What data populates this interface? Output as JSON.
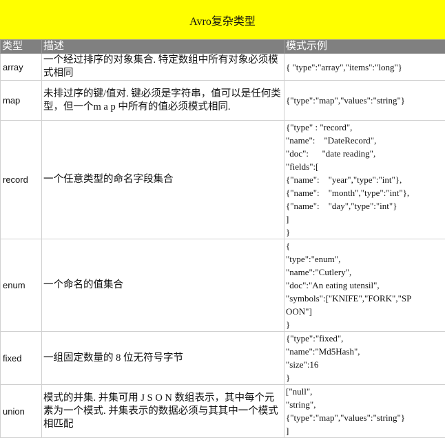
{
  "title": "Avro复杂类型",
  "headers": [
    "类型",
    "描述",
    "模式示例"
  ],
  "rows": [
    {
      "type": "array",
      "desc": "一个经过排序的对象集合. 特定数组中所有对象必须模式相同",
      "schema": "{ \"type\":\"array\",\"items\":\"long\"}"
    },
    {
      "type": "map",
      "desc": "未排过序的键/值对. 键必须是字符串，值可以是任何类型，但一个m a p 中所有的值必须模式相同.",
      "schema": "{\"type\":\"map\",\"values\":\"string\"}"
    },
    {
      "type": "record",
      "desc": "一个任意类型的命名字段集合",
      "schema": "{\"type\" : \"record\",\n\"name\":    \"DateRecord\",\n\"doc\":      \"date reading\",\n\"fields\":[\n{\"name\":    \"year\",\"type\":\"int\"},\n{\"name\":    \"month\",\"type\":\"int\"},\n{\"name\":    \"day\",\"type\":\"int\"}\n]\n}"
    },
    {
      "type": "enum",
      "desc": "一个命名的值集合",
      "schema": "{\n\"type\":\"enum\",\n\"name\":\"Cutlery\",\n\"doc\":\"An eating utensil\",\n\"symbols\":[\"KNIFE\",\"FORK\",\"SP\nOON\"]\n}"
    },
    {
      "type": "fixed",
      "desc": "一组固定数量的 8 位无符号字节",
      "schema": "{\"type\":\"fixed\",\n\"name\":\"Md5Hash\",\n\"size\":16\n}"
    },
    {
      "type": "union",
      "desc": "模式的并集. 并集可用 J S O N 数组表示，其中每个元素为一个模式. 并集表示的数据必须与其其中一个模式相匹配",
      "schema": "[\"null\",\n\"string\",\n{\"type\":\"map\",\"values\":\"string\"}\n]"
    }
  ]
}
